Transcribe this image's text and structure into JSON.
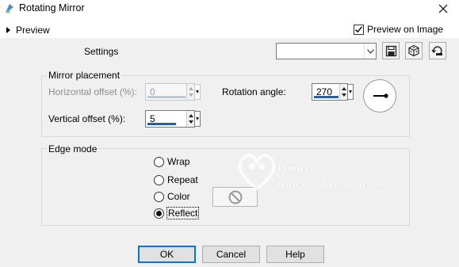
{
  "window": {
    "title": "Rotating Mirror",
    "close_glyph": "X"
  },
  "top": {
    "preview_label": "Preview",
    "preview_on_image_label": "Preview on Image",
    "preview_on_image_checked": true
  },
  "settings": {
    "label": "Settings",
    "preset_value": "",
    "tools": [
      "save-preset-icon",
      "randomize-icon",
      "reset-icon"
    ]
  },
  "mirror_placement": {
    "title": "Mirror placement",
    "horizontal_offset_label": "Horizontal offset (%):",
    "horizontal_offset_value": "0",
    "horizontal_offset_enabled": false,
    "vertical_offset_label": "Vertical offset (%):",
    "vertical_offset_value": "5",
    "rotation_angle_label": "Rotation angle:",
    "rotation_angle_value": "270"
  },
  "edge_mode": {
    "title": "Edge mode",
    "options": [
      "Wrap",
      "Repeat",
      "Color",
      "Reflect"
    ],
    "selected": "Reflect"
  },
  "watermark": {
    "line1": "Pinuccia",
    "line2": "www.maidiregrafica.eu"
  },
  "buttons": {
    "ok": "OK",
    "cancel": "Cancel",
    "help": "Help"
  },
  "colors": {
    "accent": "#0a64d6",
    "background": "#f0f0f0",
    "default_button_border": "#0078d7"
  }
}
